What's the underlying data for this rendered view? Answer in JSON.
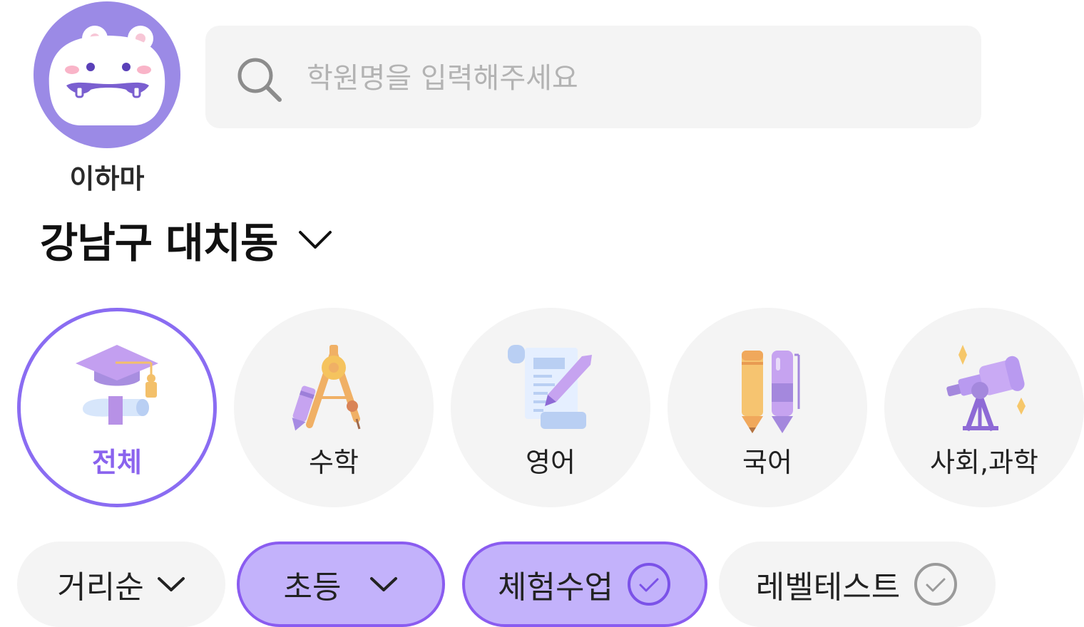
{
  "profile": {
    "name": "이하마"
  },
  "search": {
    "placeholder": "학원명을 입력해주세요",
    "value": ""
  },
  "location": {
    "label": "강남구 대치동"
  },
  "categories": [
    {
      "label": "전체",
      "icon": "graduation-cap-icon",
      "selected": true
    },
    {
      "label": "수학",
      "icon": "compass-icon",
      "selected": false
    },
    {
      "label": "영어",
      "icon": "scroll-quill-icon",
      "selected": false
    },
    {
      "label": "국어",
      "icon": "pencil-pen-icon",
      "selected": false
    },
    {
      "label": "사회,과학",
      "icon": "telescope-icon",
      "selected": false
    }
  ],
  "filters": [
    {
      "label": "거리순",
      "type": "dropdown",
      "active": false
    },
    {
      "label": "초등",
      "type": "dropdown",
      "active": true
    },
    {
      "label": "체험수업",
      "type": "toggle",
      "active": true
    },
    {
      "label": "레벨테스트",
      "type": "toggle",
      "active": false
    }
  ],
  "colors": {
    "accent": "#8a6cf2",
    "avatar_bg": "#9b8ae6",
    "chip_active_bg": "#c3b2fb",
    "inactive_bg": "#f4f4f4"
  }
}
